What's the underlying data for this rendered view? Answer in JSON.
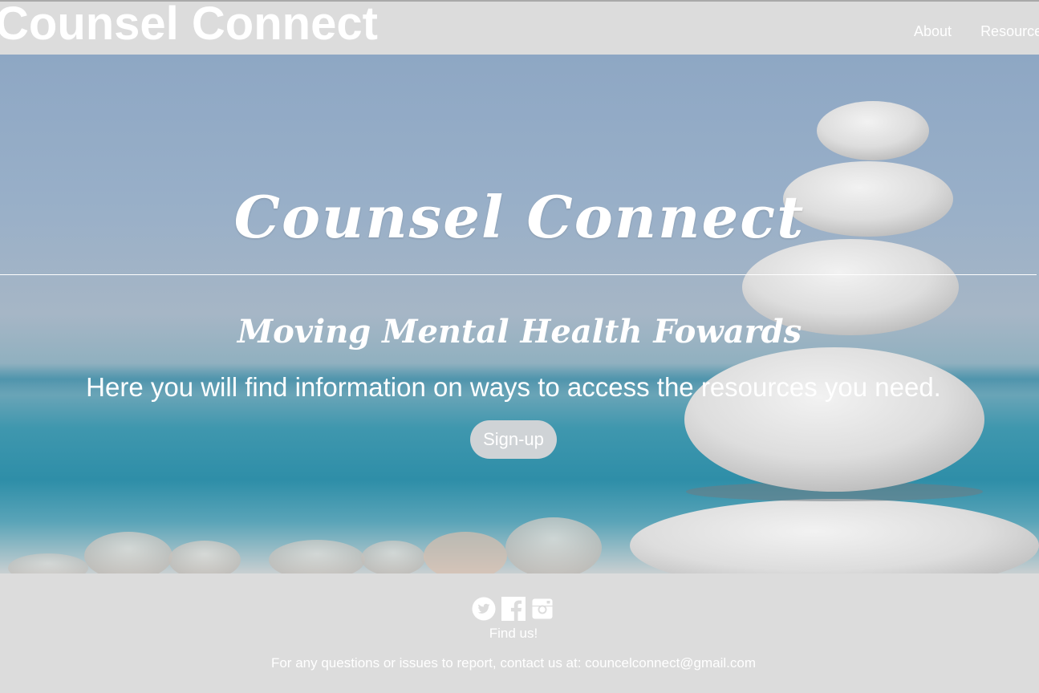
{
  "header": {
    "brand": "Counsel Connect",
    "nav": [
      {
        "label": "About"
      },
      {
        "label": "Resources"
      }
    ]
  },
  "hero": {
    "title": "Counsel Connect",
    "subtitle": "Moving Mental Health Fowards",
    "text": "Here you will find information on ways to access the resources you need.",
    "signup_label": "Sign-up"
  },
  "footer": {
    "social_icons": [
      "twitter-icon",
      "facebook-icon",
      "instagram-icon"
    ],
    "find_us": "Find us!",
    "contact": "For any questions or issues to report, contact us at: councelconnect@gmail.com"
  },
  "colors": {
    "header_bg": "#dcdcdc",
    "text": "#ffffff",
    "button_bg": "#cfd3d6"
  }
}
